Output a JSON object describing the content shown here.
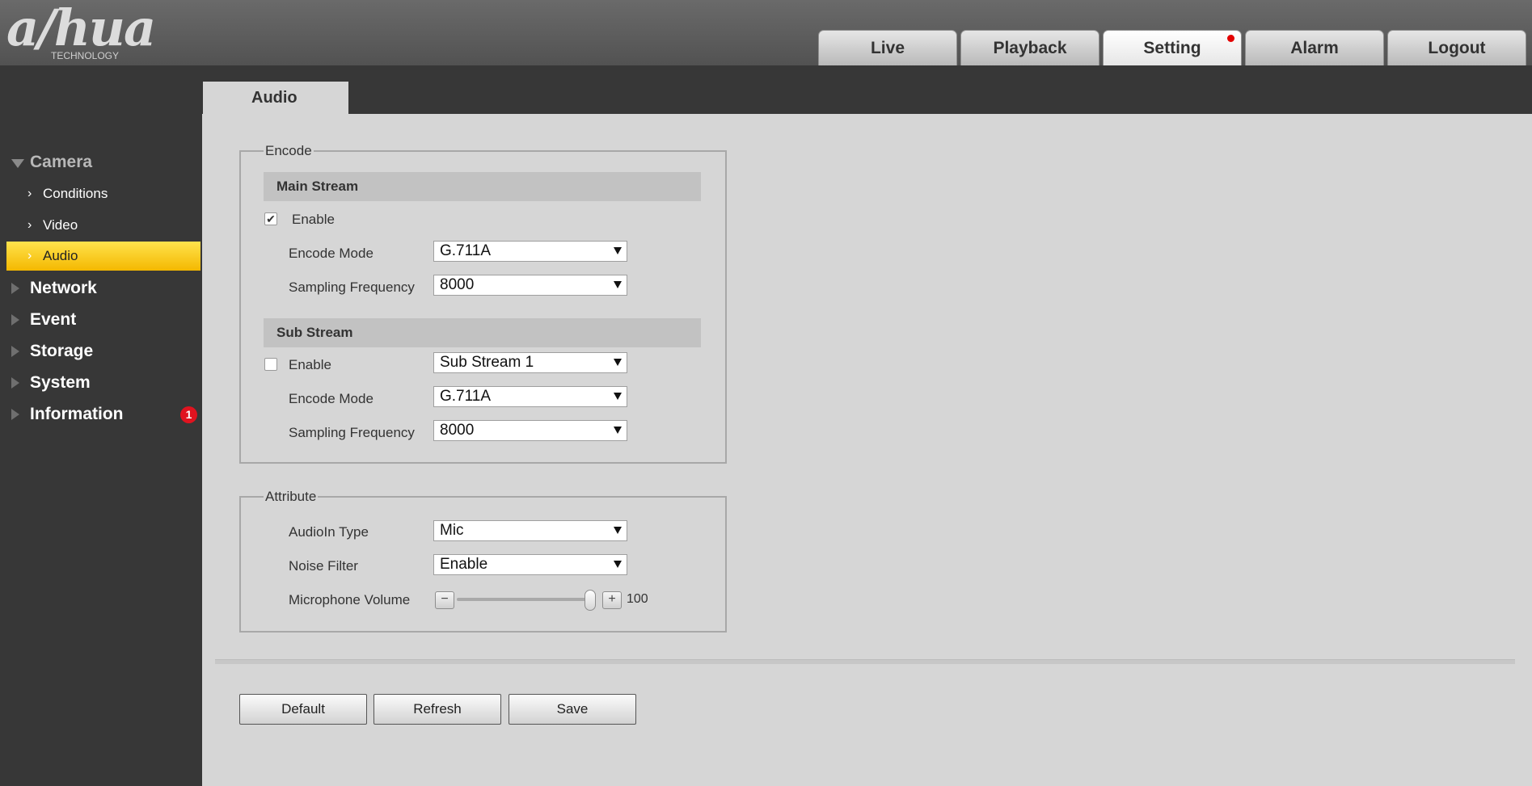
{
  "brand": {
    "logo_text": "a/hua",
    "logo_sub": "TECHNOLOGY"
  },
  "nav": {
    "tabs": [
      {
        "label": "Live"
      },
      {
        "label": "Playback"
      },
      {
        "label": "Setting"
      },
      {
        "label": "Alarm"
      },
      {
        "label": "Logout"
      }
    ],
    "active": "Setting"
  },
  "sidebar": {
    "camera": {
      "label": "Camera",
      "items": [
        "Conditions",
        "Video",
        "Audio"
      ],
      "active": "Audio"
    },
    "categories": [
      "Network",
      "Event",
      "Storage",
      "System",
      "Information"
    ],
    "information_badge": "1"
  },
  "page": {
    "tab_label": "Audio"
  },
  "encode": {
    "title": "Encode",
    "main_stream": {
      "header": "Main Stream",
      "enable_label": "Enable",
      "enable_checked": true,
      "encode_mode_label": "Encode Mode",
      "encode_mode": "G.711A",
      "sampling_label": "Sampling Frequency",
      "sampling": "8000"
    },
    "sub_stream": {
      "header": "Sub Stream",
      "enable_label": "Enable",
      "enable_checked": false,
      "stream_select": "Sub Stream 1",
      "encode_mode_label": "Encode Mode",
      "encode_mode": "G.711A",
      "sampling_label": "Sampling Frequency",
      "sampling": "8000"
    }
  },
  "attribute": {
    "title": "Attribute",
    "audioin_label": "AudioIn Type",
    "audioin": "Mic",
    "noise_label": "Noise Filter",
    "noise": "Enable",
    "volume_label": "Microphone Volume",
    "volume": "100",
    "volume_min": 0,
    "volume_max": 100,
    "minus_glyph": "−",
    "plus_glyph": "+"
  },
  "buttons": {
    "default": "Default",
    "refresh": "Refresh",
    "save": "Save"
  },
  "colors": {
    "active_item": "#ffd21f",
    "badge": "#e0131f",
    "sidebar_bg": "#373737"
  }
}
